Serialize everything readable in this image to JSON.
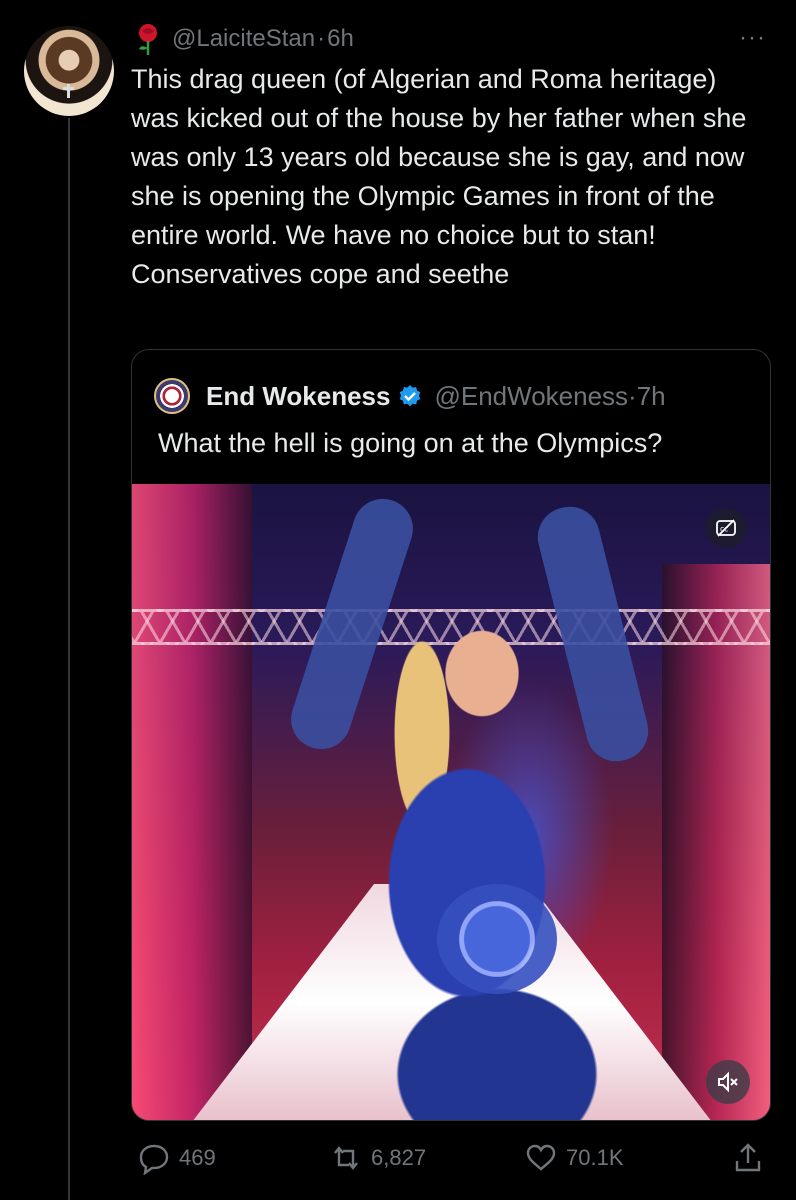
{
  "tweet": {
    "handle": "@LaiciteStan",
    "separator": "·",
    "time": "6h",
    "more_label": "···",
    "text": "This drag queen (of Algerian and Roma heritage) was kicked out of the house by her father when she was only 13 years old because she is gay, and now she is opening the Olympic Games in front of the entire world. We have no choice but to stan! Conservatives cope and seethe",
    "author_emoji_icon": "rose-icon"
  },
  "quoted": {
    "name": "End Wokeness",
    "handle": "@EndWokeness",
    "separator": "·",
    "time": "7h",
    "text": "What the hell is going on at the Olympics?",
    "verified_color": "#1d9bf0"
  },
  "actions": {
    "replies": "469",
    "retweets": "6,827",
    "likes": "70.1K"
  },
  "colors": {
    "background": "#000000",
    "text": "#e7e9ea",
    "muted": "#71767b",
    "border": "#2f3336"
  }
}
